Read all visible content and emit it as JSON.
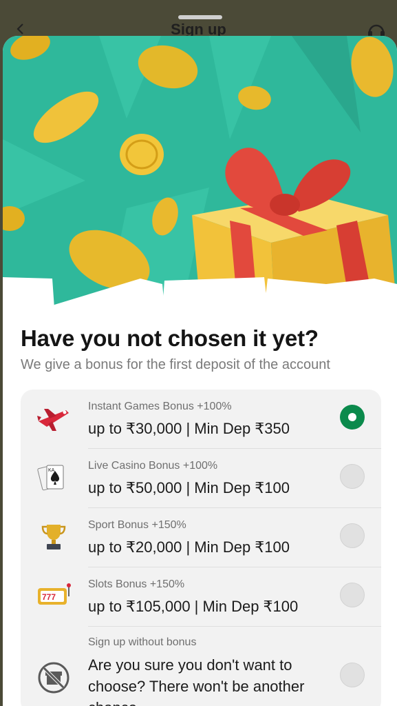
{
  "header": {
    "title": "Sign up"
  },
  "promo": {
    "title": "Have you not chosen it yet?",
    "subtitle": "We give a bonus for the first deposit of the account"
  },
  "bonuses": [
    {
      "label": "Instant Games Bonus +100%",
      "value": "up to ₹30,000 | Min Dep ₹350",
      "icon": "plane-icon",
      "selected": true
    },
    {
      "label": "Live Casino Bonus +100%",
      "value": "up to ₹50,000 | Min Dep ₹100",
      "icon": "playing-cards-icon",
      "selected": false
    },
    {
      "label": "Sport Bonus +150%",
      "value": "up to ₹20,000 | Min Dep ₹100",
      "icon": "trophy-icon",
      "selected": false
    },
    {
      "label": "Slots Bonus +150%",
      "value": "up to ₹105,000 | Min Dep ₹100",
      "icon": "slot-machine-icon",
      "selected": false
    }
  ],
  "no_bonus": {
    "label": "Sign up without bonus",
    "text": "Are you sure you don't want to choose? There won't be another chance",
    "icon": "no-gift-icon",
    "selected": false
  },
  "colors": {
    "accent": "#0b8a4c",
    "hero_bg": "#2fb89b",
    "gift": "#f2c23a",
    "ribbon": "#e2493d"
  }
}
